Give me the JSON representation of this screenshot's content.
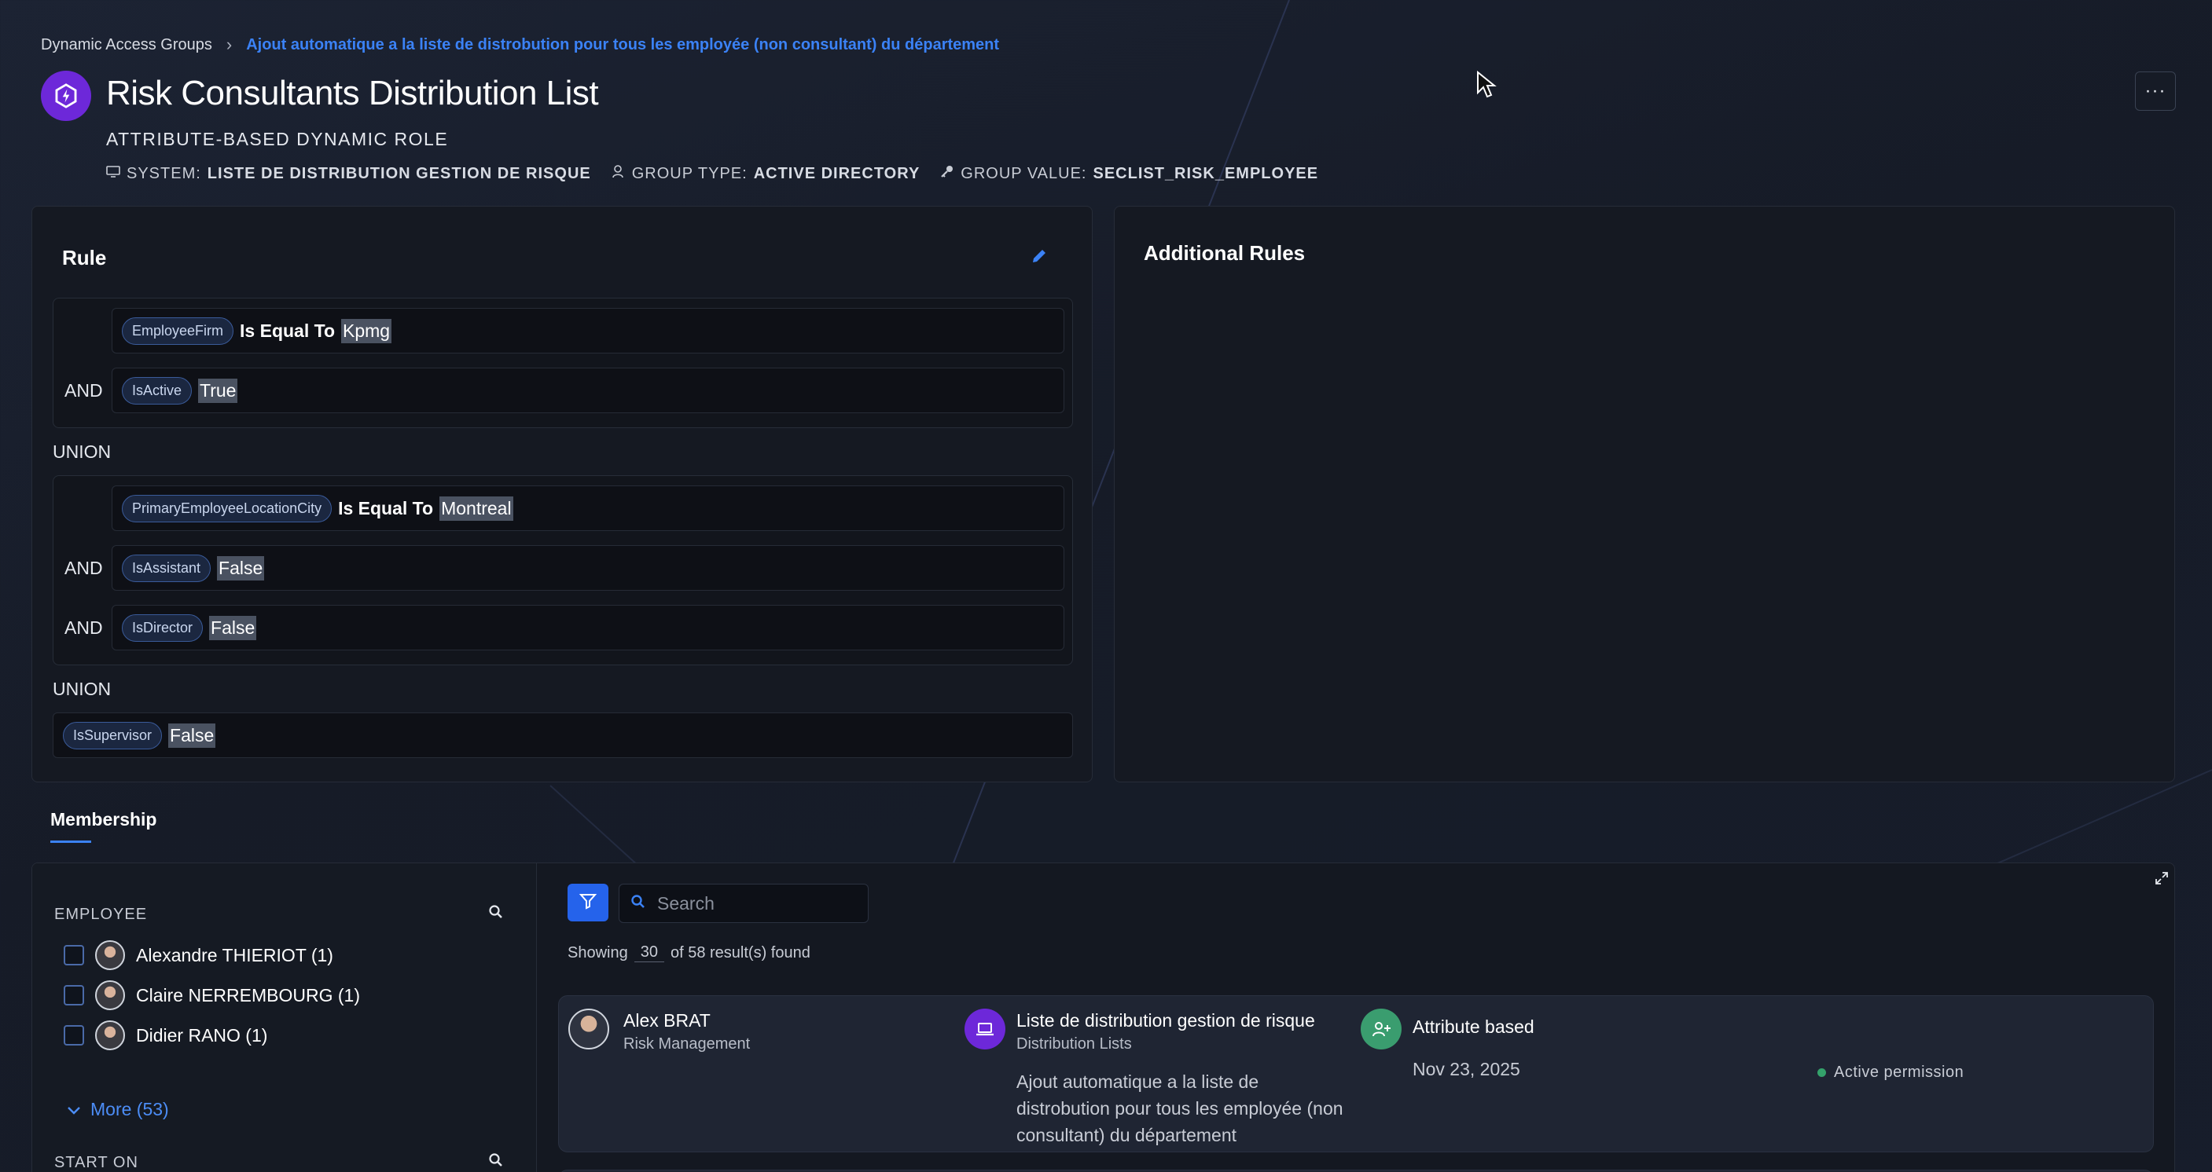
{
  "breadcrumb": {
    "root": "Dynamic Access Groups",
    "current": "Ajout automatique a la liste de distrobution pour tous les employée (non consultant) du département"
  },
  "header": {
    "title": "Risk Consultants Distribution List",
    "subtitle": "ATTRIBUTE-BASED DYNAMIC ROLE",
    "more_label": "···",
    "meta": {
      "system_label": "SYSTEM:",
      "system_value": "LISTE DE DISTRIBUTION GESTION DE RISQUE",
      "group_type_label": "GROUP TYPE:",
      "group_type_value": "ACTIVE DIRECTORY",
      "group_value_label": "GROUP VALUE:",
      "group_value_value": "SECLIST_RISK_EMPLOYEE"
    }
  },
  "rule": {
    "title": "Rule",
    "groups": [
      {
        "conditions": [
          {
            "op": "",
            "attr": "EmployeeFirm",
            "keyword": "Is Equal To",
            "value": "Kpmg"
          },
          {
            "op": "AND",
            "attr": "IsActive",
            "keyword": "",
            "value": "True"
          }
        ]
      },
      {
        "conditions": [
          {
            "op": "",
            "attr": "PrimaryEmployeeLocationCity",
            "keyword": "Is Equal To",
            "value": "Montreal"
          },
          {
            "op": "AND",
            "attr": "IsAssistant",
            "keyword": "",
            "value": "False"
          },
          {
            "op": "AND",
            "attr": "IsDirector",
            "keyword": "",
            "value": "False"
          }
        ]
      },
      {
        "conditions": [
          {
            "op": "",
            "attr": "IsSupervisor",
            "keyword": "",
            "value": "False"
          }
        ]
      }
    ],
    "union_label": "UNION"
  },
  "additional_rules": {
    "title": "Additional Rules"
  },
  "membership": {
    "tab_label": "Membership",
    "facets": {
      "employee_title": "EMPLOYEE",
      "employees": [
        {
          "name": "Alexandre THIERIOT (1)"
        },
        {
          "name": "Claire NERREMBOURG (1)"
        },
        {
          "name": "Didier RANO (1)"
        }
      ],
      "more_label": "More (53)",
      "start_on_title": "START ON"
    },
    "search_placeholder": "Search",
    "showing": {
      "prefix": "Showing",
      "count": "30",
      "suffix": "of 58 result(s) found"
    },
    "results": [
      {
        "name": "Alex BRAT",
        "department": "Risk Management",
        "system": "Liste de distribution gestion de risque",
        "system_type": "Distribution Lists",
        "description": "Ajout automatique a la liste de distrobution pour tous les employée (non consultant) du département",
        "assignment": "Attribute based",
        "date": "Nov 23, 2025",
        "status": "Active permission"
      }
    ]
  },
  "colors": {
    "accent": "#3b82f6",
    "brand_purple": "#6d28d9",
    "success": "#34a26b"
  }
}
